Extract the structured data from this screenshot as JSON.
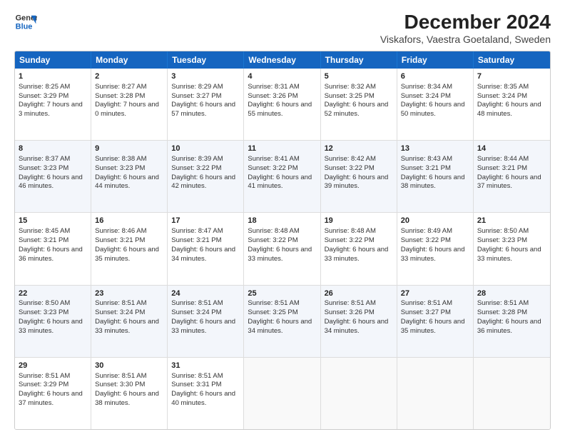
{
  "logo": {
    "line1": "General",
    "line2": "Blue"
  },
  "title": "December 2024",
  "subtitle": "Viskafors, Vaestra Goetaland, Sweden",
  "header_days": [
    "Sunday",
    "Monday",
    "Tuesday",
    "Wednesday",
    "Thursday",
    "Friday",
    "Saturday"
  ],
  "weeks": [
    [
      {
        "day": "1",
        "sunrise": "Sunrise: 8:25 AM",
        "sunset": "Sunset: 3:29 PM",
        "daylight": "Daylight: 7 hours and 3 minutes."
      },
      {
        "day": "2",
        "sunrise": "Sunrise: 8:27 AM",
        "sunset": "Sunset: 3:28 PM",
        "daylight": "Daylight: 7 hours and 0 minutes."
      },
      {
        "day": "3",
        "sunrise": "Sunrise: 8:29 AM",
        "sunset": "Sunset: 3:27 PM",
        "daylight": "Daylight: 6 hours and 57 minutes."
      },
      {
        "day": "4",
        "sunrise": "Sunrise: 8:31 AM",
        "sunset": "Sunset: 3:26 PM",
        "daylight": "Daylight: 6 hours and 55 minutes."
      },
      {
        "day": "5",
        "sunrise": "Sunrise: 8:32 AM",
        "sunset": "Sunset: 3:25 PM",
        "daylight": "Daylight: 6 hours and 52 minutes."
      },
      {
        "day": "6",
        "sunrise": "Sunrise: 8:34 AM",
        "sunset": "Sunset: 3:24 PM",
        "daylight": "Daylight: 6 hours and 50 minutes."
      },
      {
        "day": "7",
        "sunrise": "Sunrise: 8:35 AM",
        "sunset": "Sunset: 3:24 PM",
        "daylight": "Daylight: 6 hours and 48 minutes."
      }
    ],
    [
      {
        "day": "8",
        "sunrise": "Sunrise: 8:37 AM",
        "sunset": "Sunset: 3:23 PM",
        "daylight": "Daylight: 6 hours and 46 minutes."
      },
      {
        "day": "9",
        "sunrise": "Sunrise: 8:38 AM",
        "sunset": "Sunset: 3:23 PM",
        "daylight": "Daylight: 6 hours and 44 minutes."
      },
      {
        "day": "10",
        "sunrise": "Sunrise: 8:39 AM",
        "sunset": "Sunset: 3:22 PM",
        "daylight": "Daylight: 6 hours and 42 minutes."
      },
      {
        "day": "11",
        "sunrise": "Sunrise: 8:41 AM",
        "sunset": "Sunset: 3:22 PM",
        "daylight": "Daylight: 6 hours and 41 minutes."
      },
      {
        "day": "12",
        "sunrise": "Sunrise: 8:42 AM",
        "sunset": "Sunset: 3:22 PM",
        "daylight": "Daylight: 6 hours and 39 minutes."
      },
      {
        "day": "13",
        "sunrise": "Sunrise: 8:43 AM",
        "sunset": "Sunset: 3:21 PM",
        "daylight": "Daylight: 6 hours and 38 minutes."
      },
      {
        "day": "14",
        "sunrise": "Sunrise: 8:44 AM",
        "sunset": "Sunset: 3:21 PM",
        "daylight": "Daylight: 6 hours and 37 minutes."
      }
    ],
    [
      {
        "day": "15",
        "sunrise": "Sunrise: 8:45 AM",
        "sunset": "Sunset: 3:21 PM",
        "daylight": "Daylight: 6 hours and 36 minutes."
      },
      {
        "day": "16",
        "sunrise": "Sunrise: 8:46 AM",
        "sunset": "Sunset: 3:21 PM",
        "daylight": "Daylight: 6 hours and 35 minutes."
      },
      {
        "day": "17",
        "sunrise": "Sunrise: 8:47 AM",
        "sunset": "Sunset: 3:21 PM",
        "daylight": "Daylight: 6 hours and 34 minutes."
      },
      {
        "day": "18",
        "sunrise": "Sunrise: 8:48 AM",
        "sunset": "Sunset: 3:22 PM",
        "daylight": "Daylight: 6 hours and 33 minutes."
      },
      {
        "day": "19",
        "sunrise": "Sunrise: 8:48 AM",
        "sunset": "Sunset: 3:22 PM",
        "daylight": "Daylight: 6 hours and 33 minutes."
      },
      {
        "day": "20",
        "sunrise": "Sunrise: 8:49 AM",
        "sunset": "Sunset: 3:22 PM",
        "daylight": "Daylight: 6 hours and 33 minutes."
      },
      {
        "day": "21",
        "sunrise": "Sunrise: 8:50 AM",
        "sunset": "Sunset: 3:23 PM",
        "daylight": "Daylight: 6 hours and 33 minutes."
      }
    ],
    [
      {
        "day": "22",
        "sunrise": "Sunrise: 8:50 AM",
        "sunset": "Sunset: 3:23 PM",
        "daylight": "Daylight: 6 hours and 33 minutes."
      },
      {
        "day": "23",
        "sunrise": "Sunrise: 8:51 AM",
        "sunset": "Sunset: 3:24 PM",
        "daylight": "Daylight: 6 hours and 33 minutes."
      },
      {
        "day": "24",
        "sunrise": "Sunrise: 8:51 AM",
        "sunset": "Sunset: 3:24 PM",
        "daylight": "Daylight: 6 hours and 33 minutes."
      },
      {
        "day": "25",
        "sunrise": "Sunrise: 8:51 AM",
        "sunset": "Sunset: 3:25 PM",
        "daylight": "Daylight: 6 hours and 34 minutes."
      },
      {
        "day": "26",
        "sunrise": "Sunrise: 8:51 AM",
        "sunset": "Sunset: 3:26 PM",
        "daylight": "Daylight: 6 hours and 34 minutes."
      },
      {
        "day": "27",
        "sunrise": "Sunrise: 8:51 AM",
        "sunset": "Sunset: 3:27 PM",
        "daylight": "Daylight: 6 hours and 35 minutes."
      },
      {
        "day": "28",
        "sunrise": "Sunrise: 8:51 AM",
        "sunset": "Sunset: 3:28 PM",
        "daylight": "Daylight: 6 hours and 36 minutes."
      }
    ],
    [
      {
        "day": "29",
        "sunrise": "Sunrise: 8:51 AM",
        "sunset": "Sunset: 3:29 PM",
        "daylight": "Daylight: 6 hours and 37 minutes."
      },
      {
        "day": "30",
        "sunrise": "Sunrise: 8:51 AM",
        "sunset": "Sunset: 3:30 PM",
        "daylight": "Daylight: 6 hours and 38 minutes."
      },
      {
        "day": "31",
        "sunrise": "Sunrise: 8:51 AM",
        "sunset": "Sunset: 3:31 PM",
        "daylight": "Daylight: 6 hours and 40 minutes."
      },
      null,
      null,
      null,
      null
    ]
  ]
}
